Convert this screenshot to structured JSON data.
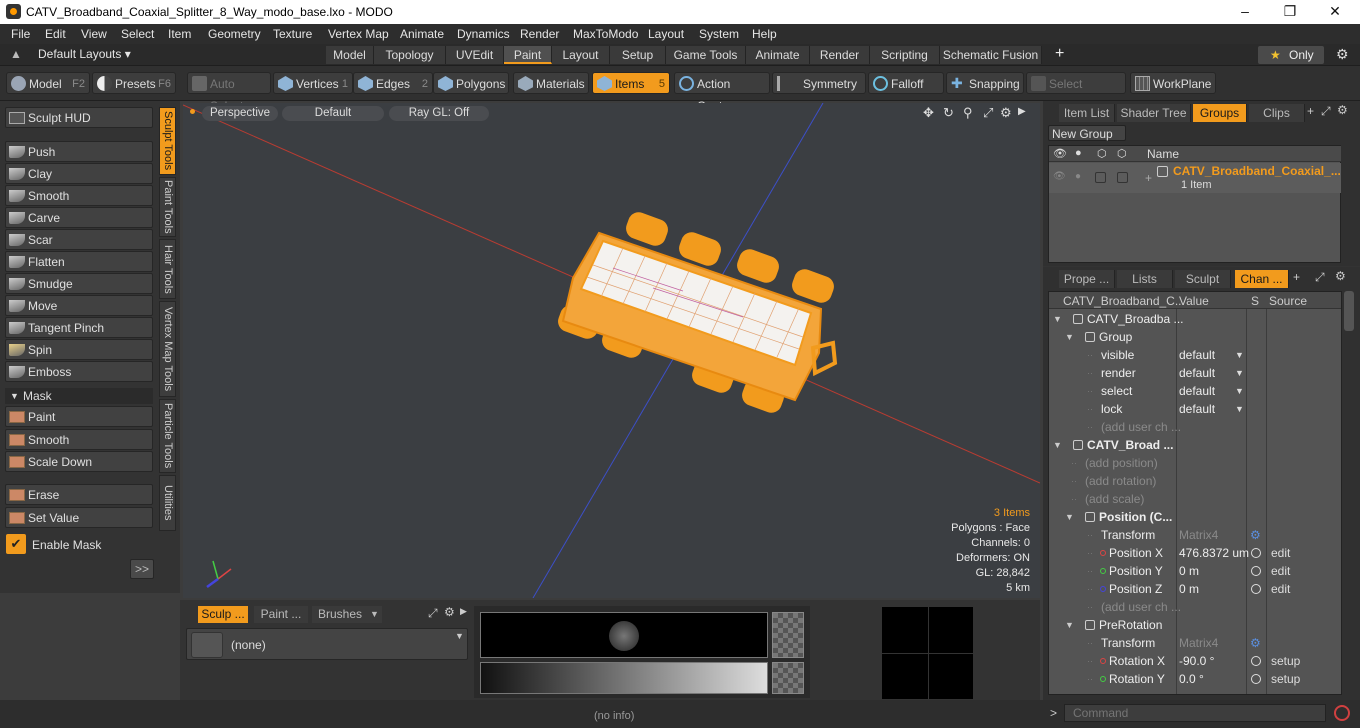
{
  "window": {
    "title": "CATV_Broadband_Coaxial_Splitter_8_Way_modo_base.lxo - MODO"
  },
  "menu": [
    "File",
    "Edit",
    "View",
    "Select",
    "Item",
    "Geometry",
    "Texture",
    "Vertex Map",
    "Animate",
    "Dynamics",
    "Render",
    "MaxToModo",
    "Layout",
    "System",
    "Help"
  ],
  "layout": {
    "default_layouts": "Default Layouts ▾",
    "tabs": [
      "Model",
      "Topology",
      "UVEdit",
      "Paint",
      "Layout",
      "Setup",
      "Game Tools",
      "Animate",
      "Render",
      "Scripting",
      "Schematic Fusion"
    ],
    "active_tab": "Paint",
    "plus": "+",
    "only": "Only"
  },
  "toolbar": {
    "model": "Model",
    "model_key": "F2",
    "presets": "Presets",
    "presets_key": "F6",
    "auto_select": "Auto Select",
    "vertices": "Vertices",
    "vertices_key": "1",
    "edges": "Edges",
    "edges_key": "2",
    "polygons": "Polygons",
    "materials": "Materials",
    "items": "Items",
    "items_key": "5",
    "action_center": "Action Center",
    "symmetry": "Symmetry",
    "falloff": "Falloff",
    "snapping": "Snapping",
    "select_through": "Select Through",
    "workplane": "WorkPlane"
  },
  "left": {
    "sculpt_hud": "Sculpt HUD",
    "tools": [
      "Push",
      "Clay",
      "Smooth",
      "Carve",
      "Scar",
      "Flatten",
      "Smudge",
      "Move",
      "Tangent Pinch",
      "Spin",
      "Emboss"
    ],
    "mask_label": "Mask",
    "mask_tools": [
      "Paint",
      "Smooth",
      "Scale Down"
    ],
    "erase": "Erase",
    "set_value": "Set Value",
    "enable_mask": "Enable Mask",
    "more": ">>",
    "vtabs": [
      "Sculpt Tools",
      "Paint Tools",
      "Hair Tools",
      "Vertex Map Tools",
      "Particle Tools",
      "Utilities"
    ]
  },
  "viewport": {
    "perspective": "Perspective",
    "default": "Default",
    "raygl": "Ray GL: Off",
    "stats": {
      "items": "3 Items",
      "polygons": "Polygons : Face",
      "channels": "Channels: 0",
      "deformers": "Deformers: ON",
      "gl": "GL: 28,842",
      "scale": "5 km"
    }
  },
  "groups_panel": {
    "tabs": [
      "Item List",
      "Shader Tree",
      "Groups",
      "Clips"
    ],
    "active": "Groups",
    "new_group": "New Group",
    "col_name": "Name",
    "item_name": "CATV_Broadband_Coaxial_...",
    "item_count": "1 Item"
  },
  "channels_panel": {
    "tabs": [
      "Prope ...",
      "Lists",
      "Sculpt",
      "Chan ..."
    ],
    "active": "Chan ...",
    "headers": {
      "name": "CATV_Broadband_C...",
      "value": "Value",
      "s": "S",
      "source": "Source"
    },
    "rows": [
      {
        "name": "CATV_Broadba ...",
        "value": "",
        "source": "",
        "indent": 0,
        "kind": "root"
      },
      {
        "name": "Group",
        "value": "",
        "source": "",
        "indent": 1,
        "kind": "head"
      },
      {
        "name": "visible",
        "value": "default",
        "source": "",
        "indent": 2,
        "kind": "drop"
      },
      {
        "name": "render",
        "value": "default",
        "source": "",
        "indent": 2,
        "kind": "drop"
      },
      {
        "name": "select",
        "value": "default",
        "source": "",
        "indent": 2,
        "kind": "drop"
      },
      {
        "name": "lock",
        "value": "default",
        "source": "",
        "indent": 2,
        "kind": "drop"
      },
      {
        "name": "(add user ch ...",
        "value": "",
        "source": "",
        "indent": 2,
        "kind": "dim"
      },
      {
        "name": "CATV_Broad ...",
        "value": "",
        "source": "",
        "indent": 0,
        "kind": "bold"
      },
      {
        "name": "(add position)",
        "value": "",
        "source": "",
        "indent": 1,
        "kind": "dim"
      },
      {
        "name": "(add rotation)",
        "value": "",
        "source": "",
        "indent": 1,
        "kind": "dim"
      },
      {
        "name": "(add scale)",
        "value": "",
        "source": "",
        "indent": 1,
        "kind": "dim"
      },
      {
        "name": "Position (C...",
        "value": "",
        "source": "",
        "indent": 1,
        "kind": "bold"
      },
      {
        "name": "Transform",
        "value": "Matrix4",
        "source": "",
        "indent": 2,
        "kind": "matrix"
      },
      {
        "name": "Position X",
        "value": "476.8372 um",
        "source": "edit",
        "indent": 2,
        "kind": "red"
      },
      {
        "name": "Position Y",
        "value": "0 m",
        "source": "edit",
        "indent": 2,
        "kind": "green"
      },
      {
        "name": "Position Z",
        "value": "0 m",
        "source": "edit",
        "indent": 2,
        "kind": "blue"
      },
      {
        "name": "(add user ch ...",
        "value": "",
        "source": "",
        "indent": 2,
        "kind": "dim"
      },
      {
        "name": "PreRotation",
        "value": "",
        "source": "",
        "indent": 1,
        "kind": "head"
      },
      {
        "name": "Transform",
        "value": "Matrix4",
        "source": "",
        "indent": 2,
        "kind": "matrix"
      },
      {
        "name": "Rotation X",
        "value": "-90.0 °",
        "source": "setup",
        "indent": 2,
        "kind": "red"
      },
      {
        "name": "Rotation Y",
        "value": "0.0 °",
        "source": "setup",
        "indent": 2,
        "kind": "green"
      }
    ]
  },
  "bottom": {
    "tabs": [
      "Sculp ...",
      "Paint ...",
      "Brushes"
    ],
    "brush_value": "(none)"
  },
  "status": {
    "info": "(no info)",
    "command_placeholder": "Command",
    "prompt": ">"
  }
}
